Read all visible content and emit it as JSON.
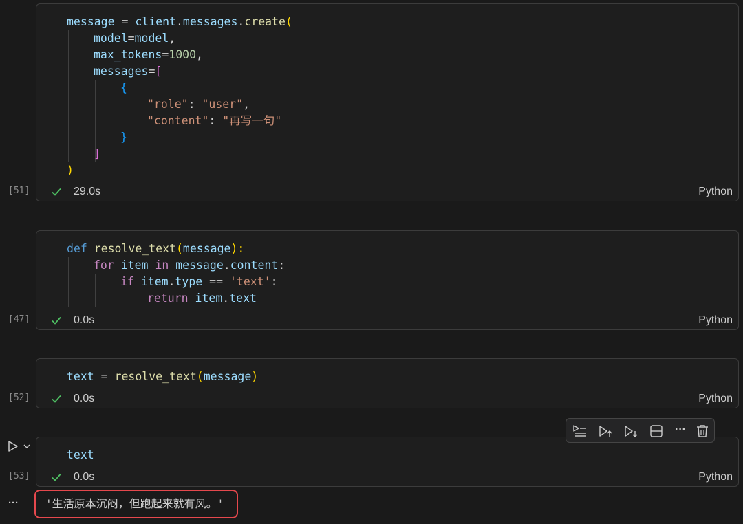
{
  "cells": [
    {
      "exec_count": "[51]",
      "duration": "29.0s",
      "language": "Python",
      "code": {
        "l1_a": "message",
        "l1_b": " = ",
        "l1_c": "client",
        "l1_d": ".",
        "l1_e": "messages",
        "l1_f": ".",
        "l1_g": "create",
        "l1_h": "(",
        "l2_a": "model",
        "l2_b": "=",
        "l2_c": "model",
        "l2_d": ",",
        "l3_a": "max_tokens",
        "l3_b": "=",
        "l3_c": "1000",
        "l3_d": ",",
        "l4_a": "messages",
        "l4_b": "=",
        "l4_c": "[",
        "l5_a": "{",
        "l6_a": "\"role\"",
        "l6_b": ": ",
        "l6_c": "\"user\"",
        "l6_d": ",",
        "l7_a": "\"content\"",
        "l7_b": ": ",
        "l7_c": "\"再写一句\"",
        "l8_a": "}",
        "l9_a": "]",
        "l10_a": ")"
      }
    },
    {
      "exec_count": "[47]",
      "duration": "0.0s",
      "language": "Python",
      "code": {
        "l1_a": "def",
        "l1_b": " ",
        "l1_c": "resolve_text",
        "l1_d": "(",
        "l1_e": "message",
        "l1_f": "):",
        "l2_a": "for",
        "l2_b": " ",
        "l2_c": "item",
        "l2_d": " ",
        "l2_e": "in",
        "l2_f": " ",
        "l2_g": "message",
        "l2_h": ".",
        "l2_i": "content",
        "l2_j": ":",
        "l3_a": "if",
        "l3_b": " ",
        "l3_c": "item",
        "l3_d": ".",
        "l3_e": "type",
        "l3_f": " == ",
        "l3_g": "'text'",
        "l3_h": ":",
        "l4_a": "return",
        "l4_b": " ",
        "l4_c": "item",
        "l4_d": ".",
        "l4_e": "text"
      }
    },
    {
      "exec_count": "[52]",
      "duration": "0.0s",
      "language": "Python",
      "code": {
        "l1_a": "text",
        "l1_b": " = ",
        "l1_c": "resolve_text",
        "l1_d": "(",
        "l1_e": "message",
        "l1_f": ")"
      }
    },
    {
      "exec_count": "[53]",
      "duration": "0.0s",
      "language": "Python",
      "code": {
        "l1_a": "text"
      }
    }
  ],
  "output": {
    "text": "'生活原本沉闷，但跑起来就有风。'",
    "more_label": "···"
  },
  "toolbar": {
    "icons": [
      "run-by-line-icon",
      "execute-above-icon",
      "execute-below-icon",
      "split-cell-icon",
      "more-icon",
      "delete-icon"
    ],
    "more_label": "···"
  },
  "colors": {
    "check": "#4ec063",
    "highlight_border": "#e5484d"
  }
}
